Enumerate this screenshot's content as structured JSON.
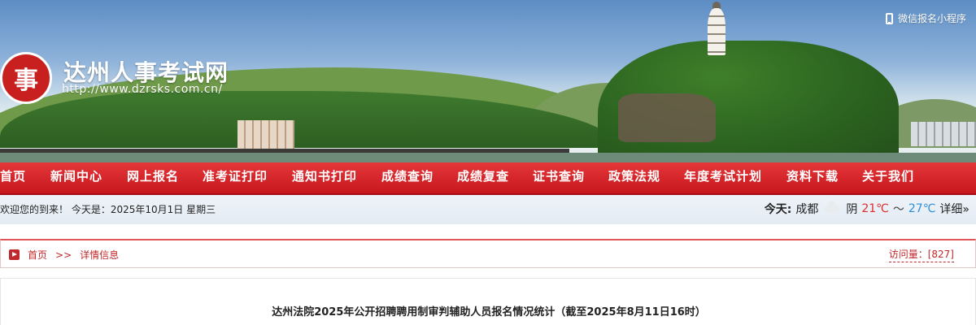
{
  "header": {
    "logo_glyph": "事",
    "site_title": "达州人事考试网",
    "site_url": "http://www.dzrsks.com.cn/",
    "wechat_label": "微信报名小程序"
  },
  "nav": {
    "items": [
      {
        "label": "首页",
        "id": "home"
      },
      {
        "label": "新闻中心",
        "id": "news"
      },
      {
        "label": "网上报名",
        "id": "signup"
      },
      {
        "label": "准考证打印",
        "id": "admission"
      },
      {
        "label": "通知书打印",
        "id": "notice"
      },
      {
        "label": "成绩查询",
        "id": "scores"
      },
      {
        "label": "成绩复查",
        "id": "review"
      },
      {
        "label": "证书查询",
        "id": "certificate"
      },
      {
        "label": "政策法规",
        "id": "policy"
      },
      {
        "label": "年度考试计划",
        "id": "plan"
      },
      {
        "label": "资料下载",
        "id": "downloads"
      },
      {
        "label": "关于我们",
        "id": "about"
      }
    ]
  },
  "welcome": {
    "text": "欢迎您的到来！ 今天是：2025年10月1日 星期三",
    "weather_label": "今天:",
    "city": "成都",
    "condition": "阴",
    "temp_high": "21℃",
    "temp_sep": "～",
    "temp_low": "27℃",
    "detail": "详细»"
  },
  "breadcrumb": {
    "home": "首页",
    "separator": ">>",
    "current": "详情信息",
    "visits": "访问量：[827]"
  },
  "article": {
    "title": "达州法院2025年公开招聘聘用制审判辅助人员报名情况统计（截至2025年8月11日16时）"
  },
  "colors": {
    "nav_red": "#d4262a",
    "accent_red": "#c0282b",
    "temp_high": "#e22b2b",
    "temp_low": "#2e8fd8"
  }
}
